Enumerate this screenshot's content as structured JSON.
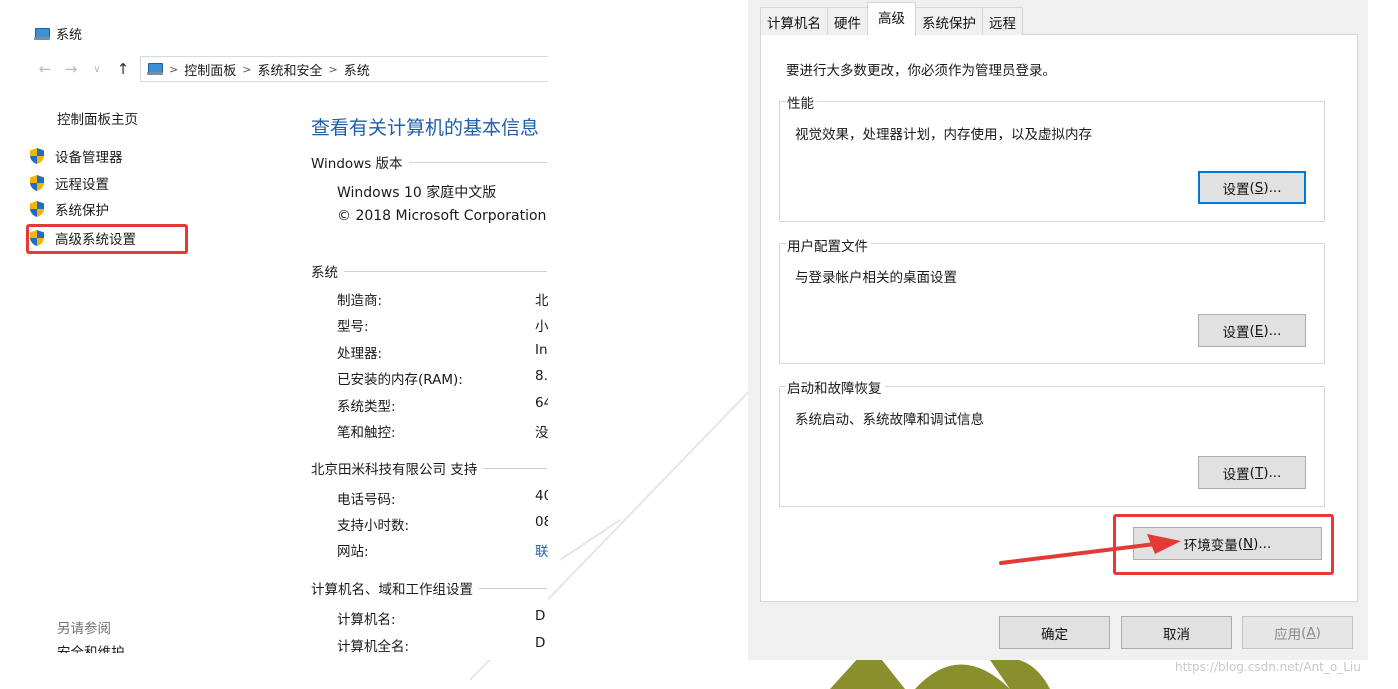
{
  "left_panel": {
    "window_title": "系统",
    "breadcrumb": [
      "控制面板",
      "系统和安全",
      "系统"
    ],
    "sidebar": {
      "home": "控制面板主页",
      "items": [
        "设备管理器",
        "远程设置",
        "系统保护",
        "高级系统设置"
      ],
      "see_also": "另请参阅",
      "see_also_item": "安全和维护"
    },
    "main": {
      "title": "查看有关计算机的基本信息",
      "windows_section": {
        "header": "Windows 版本",
        "edition": "Windows 10 家庭中文版",
        "copyright": "© 2018 Microsoft Corporation"
      },
      "system_section": {
        "header": "系统",
        "rows": [
          {
            "label": "制造商:",
            "value": "北"
          },
          {
            "label": "型号:",
            "value": "小"
          },
          {
            "label": "处理器:",
            "value": "In"
          },
          {
            "label": "已安装的内存(RAM):",
            "value": "8."
          },
          {
            "label": "系统类型:",
            "value": "64"
          },
          {
            "label": "笔和触控:",
            "value": "没"
          }
        ]
      },
      "support_section": {
        "header": "北京田米科技有限公司 支持",
        "rows": [
          {
            "label": "电话号码:",
            "value": "40"
          },
          {
            "label": "支持小时数:",
            "value": "08"
          },
          {
            "label": "网站:",
            "value": "联"
          }
        ]
      },
      "computer_section": {
        "header": "计算机名、域和工作组设置",
        "rows": [
          {
            "label": "计算机名:",
            "value": "D"
          },
          {
            "label": "计算机全名:",
            "value": "D"
          }
        ]
      }
    }
  },
  "dialog": {
    "tabs": [
      "计算机名",
      "硬件",
      "高级",
      "系统保护",
      "远程"
    ],
    "active_tab": "高级",
    "admin_note": "要进行大多数更改，你必须作为管理员登录。",
    "groups": [
      {
        "title": "性能",
        "description": "视觉效果，处理器计划，内存使用，以及虚拟内存",
        "button": "设置",
        "key": "S"
      },
      {
        "title": "用户配置文件",
        "description": "与登录帐户相关的桌面设置",
        "button": "设置",
        "key": "E"
      },
      {
        "title": "启动和故障恢复",
        "description": "系统启动、系统故障和调试信息",
        "button": "设置",
        "key": "T"
      }
    ],
    "env_button": {
      "label": "环境变量",
      "key": "N"
    },
    "footer": {
      "ok": "确定",
      "cancel": "取消",
      "apply": "应用",
      "apply_key": "A"
    }
  },
  "watermark": "https://blog.csdn.net/Ant_o_Liu",
  "colors": {
    "highlight": "#e53935",
    "link": "#1e5fa8",
    "deco": "#8a8f2e"
  }
}
